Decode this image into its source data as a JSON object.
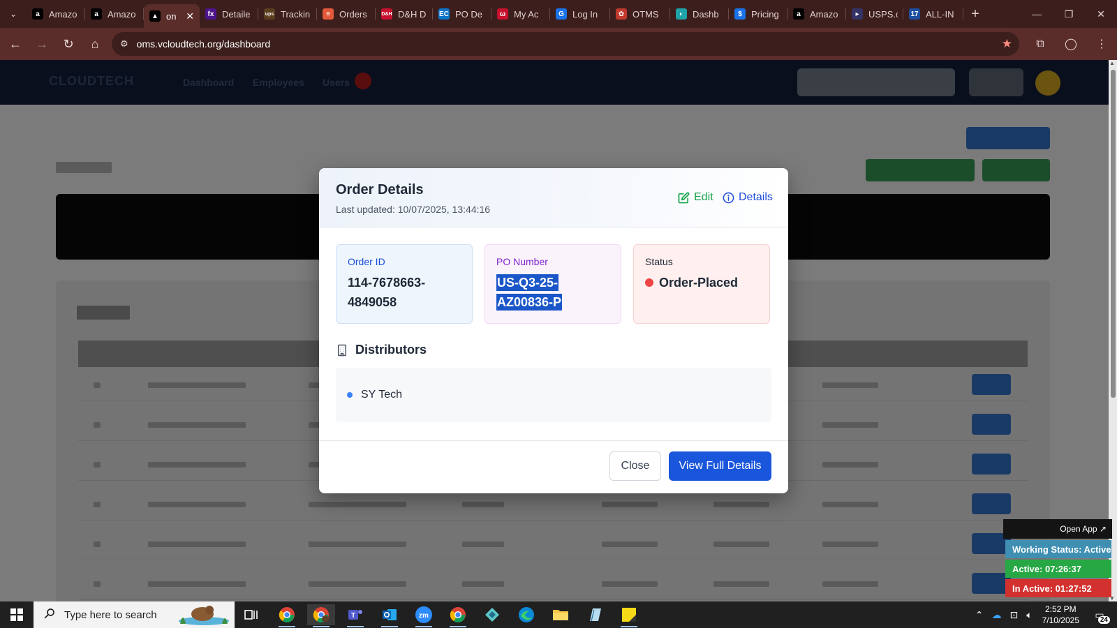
{
  "browser": {
    "tabs": [
      {
        "label": "Amazo",
        "icon": "amazon-icon",
        "color": "#000000",
        "glyph": "a"
      },
      {
        "label": "Amazo",
        "icon": "amazon-icon",
        "color": "#000000",
        "glyph": "a"
      },
      {
        "label": "on",
        "icon": "triangle-icon",
        "color": "#000000",
        "glyph": "▲",
        "active": true
      },
      {
        "label": "Detaile",
        "icon": "fedex-icon",
        "color": "#4d148c",
        "glyph": "fx"
      },
      {
        "label": "Trackin",
        "icon": "ups-icon",
        "color": "#5a3d1f",
        "glyph": "ups"
      },
      {
        "label": "Orders",
        "icon": "stack-icon",
        "color": "#e25a3a",
        "glyph": "≡"
      },
      {
        "label": "D&H D",
        "icon": "dh-icon",
        "color": "#c8102e",
        "glyph": "D&H"
      },
      {
        "label": "PO De",
        "icon": "ec-icon",
        "color": "#0a74c9",
        "glyph": "EC"
      },
      {
        "label": "My Ac",
        "icon": "circle-logo-icon",
        "color": "#c8102e",
        "glyph": "ω"
      },
      {
        "label": "Log In",
        "icon": "login-icon",
        "color": "#1a73e8",
        "glyph": "G"
      },
      {
        "label": "OTMS",
        "icon": "otms-icon",
        "color": "#c0392b",
        "glyph": "✿"
      },
      {
        "label": "Dashb",
        "icon": "dashboard-logo-icon",
        "color": "#1fa2a8",
        "glyph": "◐"
      },
      {
        "label": "Pricing",
        "icon": "dollar-icon",
        "color": "#1a73e8",
        "glyph": "$"
      },
      {
        "label": "Amazo",
        "icon": "amazon-icon",
        "color": "#000000",
        "glyph": "a"
      },
      {
        "label": "USPS.c",
        "icon": "usps-icon",
        "color": "#333366",
        "glyph": "▸"
      },
      {
        "label": "ALL-IN",
        "icon": "seventeen-icon",
        "color": "#1c4fa0",
        "glyph": "17"
      }
    ],
    "url": "oms.vcloudtech.org/dashboard"
  },
  "app": {
    "logo": "CLOUDTECH",
    "nav": [
      "Dashboard",
      "Employees",
      "Users"
    ]
  },
  "modal": {
    "title": "Order Details",
    "subtitle": "Last updated: 10/07/2025, 13:44:16",
    "edit_label": "Edit",
    "details_label": "Details",
    "order_id_label": "Order ID",
    "order_id_line1": "114-7678663-",
    "order_id_line2": "4849058",
    "po_label": "PO Number",
    "po_line1": "US-Q3-25-",
    "po_line2": "AZ00836-P",
    "status_label": "Status",
    "status_value": "Order-Placed",
    "distributors_heading": "Distributors",
    "distributors": [
      "SY Tech"
    ],
    "close_label": "Close",
    "view_label": "View Full Details",
    "colors": {
      "accent": "#1a56db",
      "edit": "#16a34a",
      "status": "#ef4444",
      "po": "#7e22ce"
    }
  },
  "tracker": {
    "open_app": "Open App ↗",
    "working": "Working Status: Active",
    "active": "Active: 07:26:37",
    "inactive": "In Active: 01:27:52"
  },
  "taskbar": {
    "search_placeholder": "Type here to search",
    "time": "2:52 PM",
    "date": "7/10/2025",
    "notifications": "24"
  }
}
